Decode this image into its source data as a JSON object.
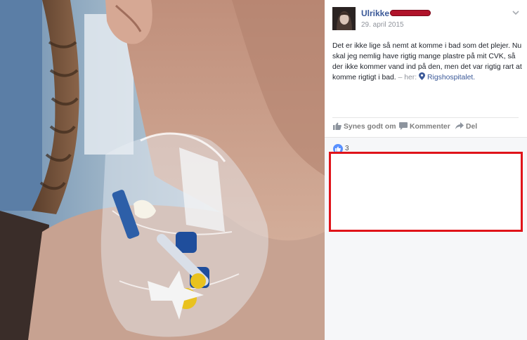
{
  "post": {
    "author": "Ulrikke",
    "date": "29. april 2015",
    "text": "Det er ikke lige så nemt at komme i bad som det plejer. Nu skal jeg nemlig have rigtig mange plastre på mit CVK, så der ikke kommer vand ind på den, men det var rigtig rart at komme rigtigt i bad.",
    "location_prefix": "– her:",
    "location": "Rigshospitalet."
  },
  "actions": {
    "like_label": "Synes godt om",
    "comment_label": "Kommenter",
    "share_label": "Del"
  },
  "feedback": {
    "like_count": "3"
  },
  "colors": {
    "link": "#3b5998",
    "highlight_border": "#e0141a",
    "redaction": "#b0132a",
    "like_bubble": "#5890ff"
  },
  "icons": [
    "chevron-down-icon",
    "location-pin-icon",
    "thumbs-up-icon",
    "comment-icon",
    "share-icon",
    "like-reaction-icon"
  ]
}
